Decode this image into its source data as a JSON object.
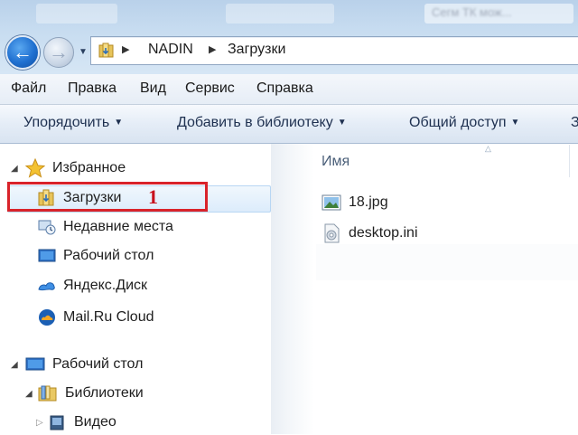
{
  "address_bar": {
    "crumbs": [
      "NADIN",
      "Загрузки"
    ],
    "background_tabs": [
      "Сегм ТК мож..."
    ]
  },
  "menu": {
    "items": [
      "Файл",
      "Правка",
      "Вид",
      "Сервис",
      "Справка"
    ]
  },
  "command_bar": {
    "items": [
      "Упорядочить",
      "Добавить в библиотеку",
      "Общий доступ",
      "З"
    ]
  },
  "nav_pane": {
    "favorites": {
      "label": "Избранное",
      "items": [
        {
          "label": "Загрузки",
          "icon": "downloads-folder-icon",
          "selected": true
        },
        {
          "label": "Недавние места",
          "icon": "recent-places-icon"
        },
        {
          "label": "Рабочий стол",
          "icon": "desktop-icon"
        },
        {
          "label": "Яндекс.Диск",
          "icon": "yandex-disk-icon"
        },
        {
          "label": "Mail.Ru Cloud",
          "icon": "mailru-cloud-icon"
        }
      ]
    },
    "desktop": {
      "label": "Рабочий стол",
      "children": [
        {
          "label": "Библиотеки",
          "icon": "libraries-icon"
        },
        {
          "label": "Видео",
          "icon": "video-library-icon"
        }
      ]
    }
  },
  "content": {
    "column_header": "Имя",
    "files": [
      {
        "name": "18.jpg",
        "icon": "image-file-icon"
      },
      {
        "name": "desktop.ini",
        "icon": "settings-file-icon"
      }
    ]
  },
  "annotation": {
    "number": "1",
    "color": "#d9232a"
  }
}
